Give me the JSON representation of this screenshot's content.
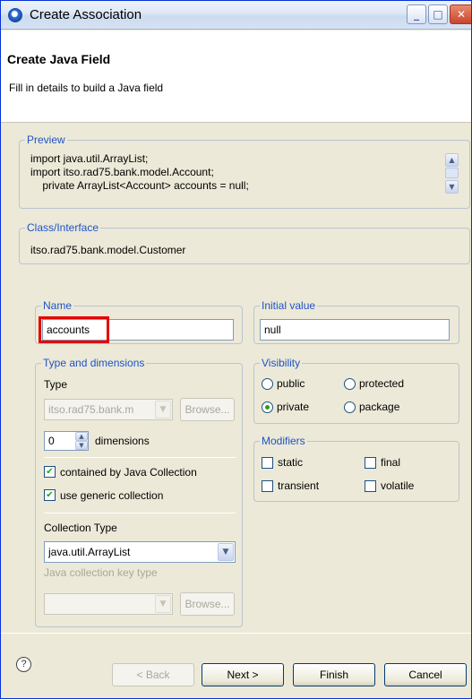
{
  "window": {
    "title": "Create Association"
  },
  "header": {
    "title": "Create Java Field",
    "description": "Fill in details to build a Java field"
  },
  "preview": {
    "legend": "Preview",
    "lines": [
      "import java.util.ArrayList;",
      "import itso.rad75.bank.model.Account;",
      "    private ArrayList<Account> accounts = null;"
    ]
  },
  "class_interface": {
    "legend": "Class/Interface",
    "value": "itso.rad75.bank.model.Customer"
  },
  "name": {
    "legend": "Name",
    "value": "accounts"
  },
  "initial_value": {
    "legend": "Initial value",
    "value": "null"
  },
  "type_dimensions": {
    "legend": "Type and dimensions",
    "type_label": "Type",
    "type_value": "itso.rad75.bank.m",
    "browse_label": "Browse...",
    "dimensions_value": "0",
    "dimensions_label": "dimensions",
    "contained_label": "contained by Java Collection",
    "generic_label": "use generic collection",
    "collection_type_label": "Collection Type",
    "collection_type_value": "java.util.ArrayList",
    "key_type_label": "Java collection key type",
    "key_type_value": "",
    "key_browse_label": "Browse..."
  },
  "visibility": {
    "legend": "Visibility",
    "options": {
      "public": "public",
      "protected": "protected",
      "private": "private",
      "package": "package"
    },
    "selected": "private"
  },
  "modifiers": {
    "legend": "Modifiers",
    "static": "static",
    "final": "final",
    "transient": "transient",
    "volatile": "volatile"
  },
  "footer": {
    "help": "?",
    "back": "< Back",
    "next": "Next >",
    "finish": "Finish",
    "cancel": "Cancel"
  },
  "colors": {
    "legend": "#1e53c8",
    "highlight": "#e60000",
    "check": "#21a121"
  }
}
